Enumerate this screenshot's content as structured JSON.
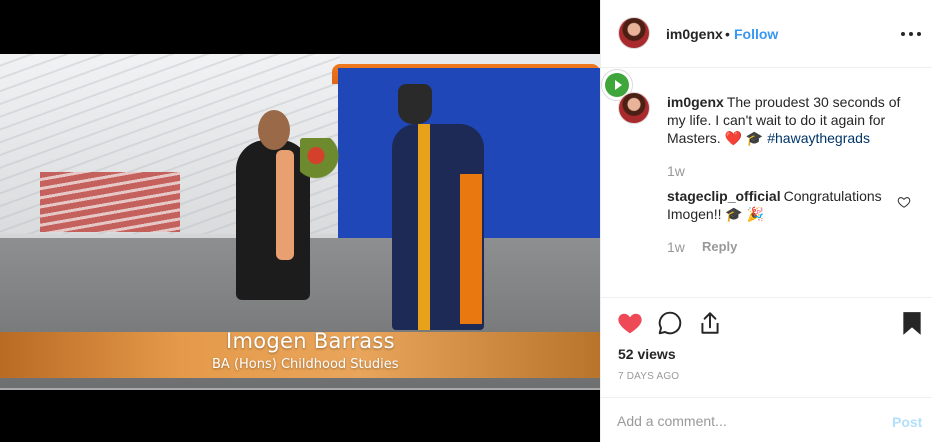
{
  "media": {
    "caption_name": "Imogen Barrass",
    "caption_sub": "BA (Hons) Childhood Studies"
  },
  "header": {
    "username": "im0genx",
    "separator": "•",
    "follow_label": "Follow"
  },
  "comments": [
    {
      "username": "im0genx",
      "text": "The proudest 30 seconds of my life. I can't wait to do it again for Masters. ❤️ 🎓 ",
      "hashtag": "#hawaythegrads",
      "time": "1w"
    },
    {
      "username": "stageclip_official",
      "text": "Congratulations Imogen!! 🎓 🎉",
      "time": "1w",
      "reply_label": "Reply"
    }
  ],
  "actions": {
    "views": "52 views",
    "date": "7 DAYS AGO",
    "like_color": "#ed4956"
  },
  "composer": {
    "placeholder": "Add a comment...",
    "post_label": "Post"
  },
  "colors": {
    "link": "#3897f0",
    "hashtag": "#003569",
    "muted": "#999999"
  }
}
